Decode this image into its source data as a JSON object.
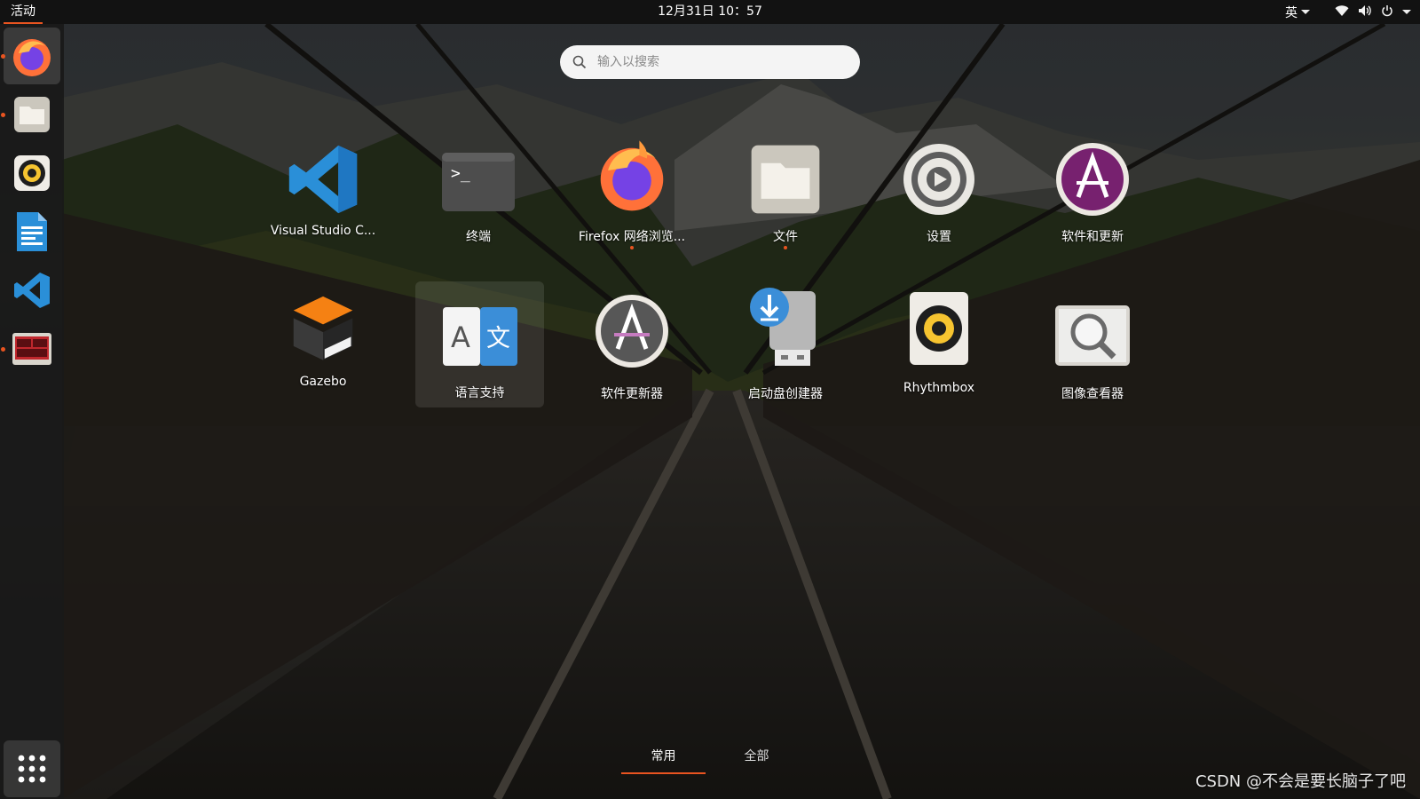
{
  "topbar": {
    "activities": "活动",
    "clock": "12月31日 10：57",
    "input_method": "英",
    "tray_icons": [
      "wifi-icon",
      "volume-icon",
      "power-icon",
      "chevron-down-icon"
    ]
  },
  "dock": {
    "items": [
      {
        "name": "firefox",
        "icon": "firefox-icon",
        "running": true,
        "active": true
      },
      {
        "name": "files",
        "icon": "folder-icon",
        "running": true,
        "active": false
      },
      {
        "name": "rhythmbox",
        "icon": "speaker-icon",
        "running": false,
        "active": false
      },
      {
        "name": "libreoffice-writer",
        "icon": "document-icon",
        "running": false,
        "active": false
      },
      {
        "name": "vscode",
        "icon": "vscode-icon",
        "running": false,
        "active": false
      },
      {
        "name": "terminal-app",
        "icon": "terminal-screen-icon",
        "running": true,
        "active": false
      }
    ],
    "show_apps_icon": "grid-icon"
  },
  "search": {
    "placeholder": "输入以搜索",
    "icon": "search-icon"
  },
  "apps": [
    {
      "label": "Visual Studio C...",
      "icon": "vscode-icon",
      "running": false
    },
    {
      "label": "终端",
      "icon": "terminal-icon",
      "running": false
    },
    {
      "label": "Firefox 网络浏览...",
      "icon": "firefox-icon",
      "running": true
    },
    {
      "label": "文件",
      "icon": "folder-icon",
      "running": true
    },
    {
      "label": "设置",
      "icon": "settings-gear-icon",
      "running": false
    },
    {
      "label": "软件和更新",
      "icon": "software-updates-icon",
      "running": false
    },
    {
      "label": "Gazebo",
      "icon": "gazebo-icon",
      "running": false
    },
    {
      "label": "语言支持",
      "icon": "language-support-icon",
      "running": false,
      "highlighted": true
    },
    {
      "label": "软件更新器",
      "icon": "software-updater-icon",
      "running": false
    },
    {
      "label": "启动盘创建器",
      "icon": "usb-creator-icon",
      "running": false
    },
    {
      "label": "Rhythmbox",
      "icon": "speaker-icon",
      "running": false
    },
    {
      "label": "图像查看器",
      "icon": "image-viewer-icon",
      "running": false
    }
  ],
  "tabs": [
    {
      "label": "常用",
      "selected": true
    },
    {
      "label": "全部",
      "selected": false
    }
  ],
  "watermark": "CSDN @不会是要长脑子了吧",
  "colors": {
    "accent": "#e95420",
    "topbar": "#121212",
    "dock": "#191919",
    "vscode_blue": "#2a8fd8",
    "firefox_orange": "#ff7139",
    "ubuntu_purple": "#77216f"
  }
}
